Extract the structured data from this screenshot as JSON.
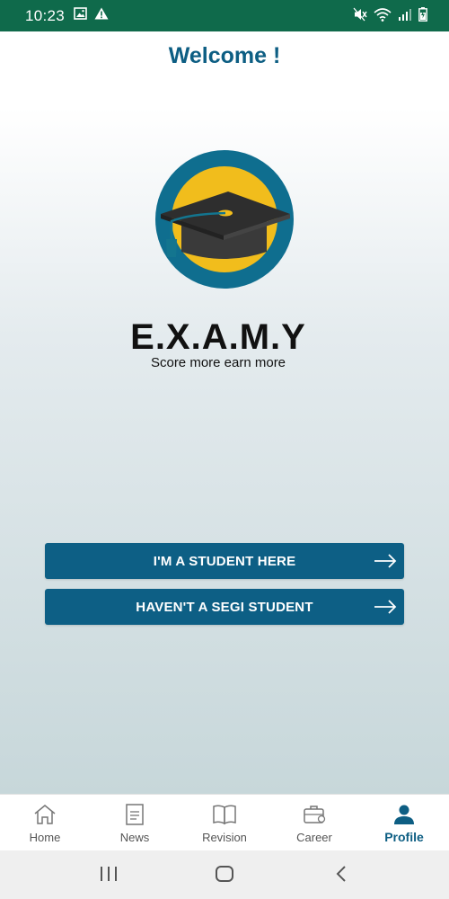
{
  "status_bar": {
    "time": "10:23",
    "left_icons": [
      "image-icon",
      "warning-icon"
    ],
    "right_icons": [
      "mute-icon",
      "wifi-icon",
      "signal-icon",
      "battery-icon"
    ]
  },
  "page": {
    "title": "Welcome !",
    "logo": {
      "brand": "E.X.A.M.Y",
      "tagline": "Score more earn more",
      "icon": "graduation-cap-icon",
      "colors": {
        "ring": "#0f6e8f",
        "fill": "#f1bd1c",
        "cap": "#3b3b3b"
      }
    }
  },
  "buttons": {
    "student": "I'M A STUDENT HERE",
    "guest": "HAVEN'T A SEGI STUDENT"
  },
  "bottom_nav": {
    "items": [
      {
        "label": "Home",
        "icon": "home-icon"
      },
      {
        "label": "News",
        "icon": "news-icon"
      },
      {
        "label": "Revision",
        "icon": "book-icon"
      },
      {
        "label": "Career",
        "icon": "briefcase-icon"
      },
      {
        "label": "Profile",
        "icon": "profile-icon",
        "active": true
      }
    ]
  },
  "colors": {
    "status_bar": "#0f6a4b",
    "accent": "#0d5e83",
    "button": "#0d5f85"
  }
}
